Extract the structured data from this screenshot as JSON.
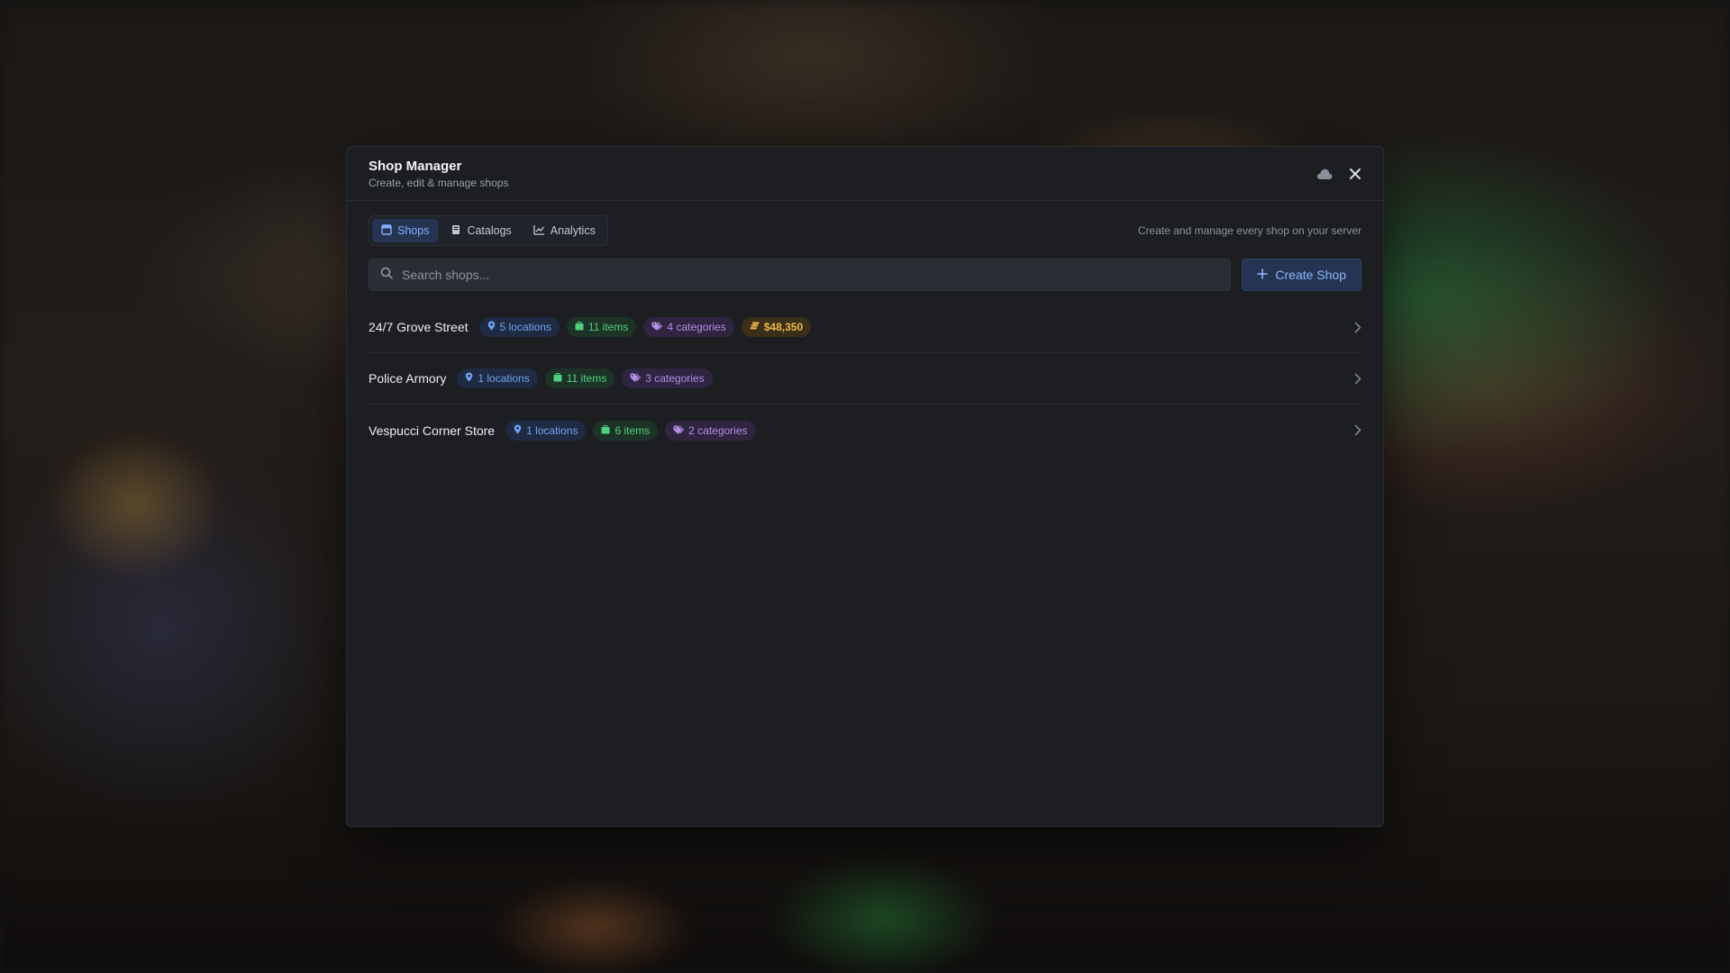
{
  "header": {
    "title": "Shop Manager",
    "subtitle": "Create, edit & manage shops"
  },
  "tabs": [
    {
      "label": "Shops",
      "icon": "store-icon",
      "active": true
    },
    {
      "label": "Catalogs",
      "icon": "book-icon",
      "active": false
    },
    {
      "label": "Analytics",
      "icon": "chart-icon",
      "active": false
    }
  ],
  "toolbar": {
    "hint": "Create and manage every shop on your server"
  },
  "search": {
    "placeholder": "Search shops...",
    "value": ""
  },
  "create_button": {
    "label": "Create Shop"
  },
  "shops": [
    {
      "name": "24/7 Grove Street",
      "locations": "5 locations",
      "items": "11 items",
      "categories": "4 categories",
      "revenue": "$48,350"
    },
    {
      "name": "Police Armory",
      "locations": "1 locations",
      "items": "11 items",
      "categories": "3 categories"
    },
    {
      "name": "Vespucci Corner Store",
      "locations": "1 locations",
      "items": "6 items",
      "categories": "2 categories"
    }
  ],
  "colors": {
    "accent": "#7fb0ff",
    "location_badge": "#6fa3f2",
    "item_badge": "#4fd07c",
    "category_badge": "#b48de6",
    "revenue_badge": "#f0b84a"
  }
}
